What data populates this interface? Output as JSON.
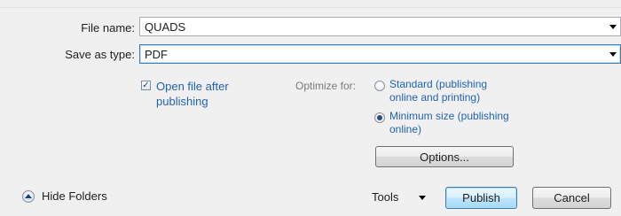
{
  "file_name": {
    "label": "File name:",
    "value": "QUADS"
  },
  "save_as_type": {
    "label": "Save as type:",
    "value": "PDF"
  },
  "open_after": {
    "label_line1": "Open file after",
    "label_line2": "publishing",
    "checked": true
  },
  "optimize": {
    "label": "Optimize for:",
    "standard": {
      "line1": "Standard (publishing",
      "line2": "online and printing)",
      "selected": false
    },
    "minimum": {
      "line1": "Minimum size (publishing",
      "line2": "online)",
      "selected": true
    }
  },
  "options_button": "Options...",
  "footer": {
    "hide_folders": "Hide Folders",
    "tools": "Tools",
    "publish": "Publish",
    "cancel": "Cancel"
  },
  "colors": {
    "link_blue": "#1f62b5",
    "focus_blue": "#3c7fb1"
  }
}
